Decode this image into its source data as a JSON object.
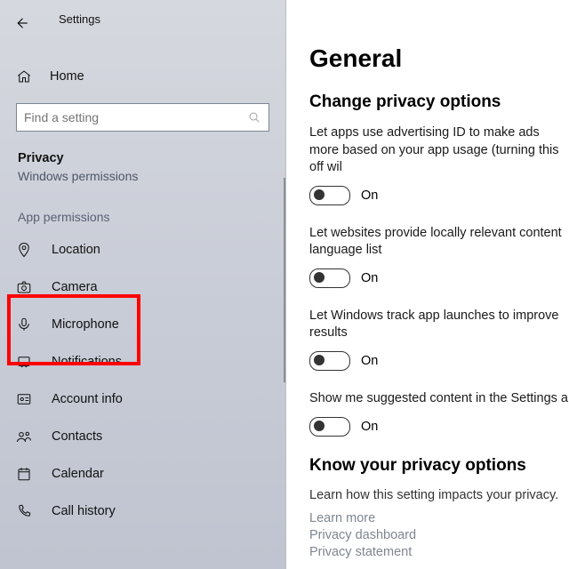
{
  "appTitle": "Settings",
  "homeLabel": "Home",
  "search": {
    "placeholder": "Find a setting"
  },
  "sectionHead": "Privacy",
  "sectionSub": "Windows permissions",
  "groupLabel": "App permissions",
  "nav": {
    "location": "Location",
    "camera": "Camera",
    "microphone": "Microphone",
    "notifications": "Notifications",
    "account": "Account info",
    "contacts": "Contacts",
    "calendar": "Calendar",
    "callhistory": "Call history"
  },
  "content": {
    "h1": "General",
    "h2a": "Change privacy options",
    "opts": [
      {
        "desc": "Let apps use advertising ID to make ads more based on your app usage (turning this off wil",
        "state": "On"
      },
      {
        "desc": "Let websites provide locally relevant content language list",
        "state": "On"
      },
      {
        "desc": "Let Windows track app launches to improve results",
        "state": "On"
      },
      {
        "desc": "Show me suggested content in the Settings a",
        "state": "On"
      }
    ],
    "h2b": "Know your privacy options",
    "knowSub": "Learn how this setting impacts your privacy.",
    "links": [
      "Learn more",
      "Privacy dashboard",
      "Privacy statement"
    ]
  }
}
